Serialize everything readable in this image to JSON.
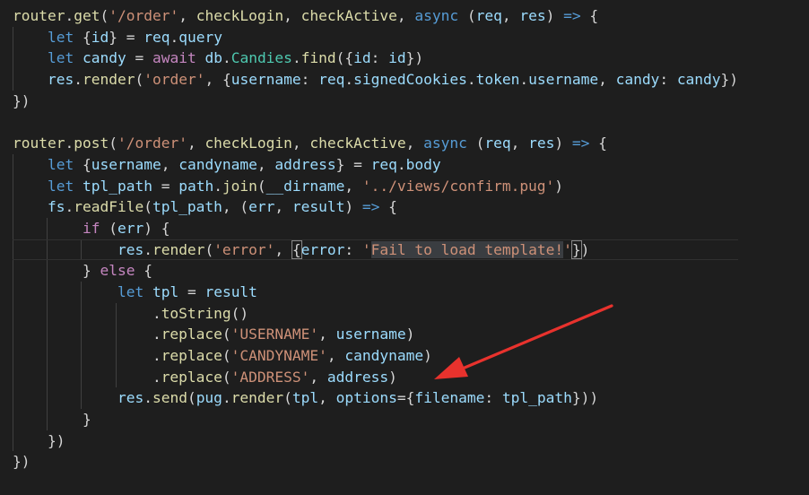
{
  "editor": {
    "lines": [
      [
        [
          "router",
          "fn"
        ],
        [
          ".",
          ""
        ],
        [
          "get",
          "fn"
        ],
        [
          "(",
          ""
        ],
        [
          "'/order'",
          "str"
        ],
        [
          ", ",
          ""
        ],
        [
          "checkLogin",
          "fn"
        ],
        [
          ", ",
          ""
        ],
        [
          "checkActive",
          "fn"
        ],
        [
          ", ",
          ""
        ],
        [
          "async",
          "kw"
        ],
        [
          " (",
          ""
        ],
        [
          "req",
          "var"
        ],
        [
          ", ",
          ""
        ],
        [
          "res",
          "var"
        ],
        [
          ") ",
          ""
        ],
        [
          "=>",
          "kw"
        ],
        [
          " {",
          ""
        ]
      ],
      [
        [
          "let",
          "kw"
        ],
        [
          " {",
          ""
        ],
        [
          "id",
          "var"
        ],
        [
          "} = ",
          ""
        ],
        [
          "req",
          "var"
        ],
        [
          ".",
          ""
        ],
        [
          "query",
          "var"
        ]
      ],
      [
        [
          "let",
          "kw"
        ],
        [
          " ",
          ""
        ],
        [
          "candy",
          "var"
        ],
        [
          " = ",
          ""
        ],
        [
          "await",
          "ctl"
        ],
        [
          " ",
          ""
        ],
        [
          "db",
          "var"
        ],
        [
          ".",
          ""
        ],
        [
          "Candies",
          "type"
        ],
        [
          ".",
          ""
        ],
        [
          "find",
          "fn"
        ],
        [
          "({",
          ""
        ],
        [
          "id",
          "var"
        ],
        [
          ": ",
          ""
        ],
        [
          "id",
          "var"
        ],
        [
          "})",
          ""
        ]
      ],
      [
        [
          "res",
          "var"
        ],
        [
          ".",
          ""
        ],
        [
          "render",
          "fn"
        ],
        [
          "(",
          ""
        ],
        [
          "'order'",
          "str"
        ],
        [
          ", {",
          ""
        ],
        [
          "username",
          "var"
        ],
        [
          ": ",
          ""
        ],
        [
          "req",
          "var"
        ],
        [
          ".",
          ""
        ],
        [
          "signedCookies",
          "var"
        ],
        [
          ".",
          ""
        ],
        [
          "token",
          "var"
        ],
        [
          ".",
          ""
        ],
        [
          "username",
          "var"
        ],
        [
          ", ",
          ""
        ],
        [
          "candy",
          "var"
        ],
        [
          ": ",
          ""
        ],
        [
          "candy",
          "var"
        ],
        [
          "})",
          ""
        ]
      ],
      [
        [
          "})",
          ""
        ]
      ],
      [],
      [
        [
          "router",
          "fn"
        ],
        [
          ".",
          ""
        ],
        [
          "post",
          "fn"
        ],
        [
          "(",
          ""
        ],
        [
          "'/order'",
          "str"
        ],
        [
          ", ",
          ""
        ],
        [
          "checkLogin",
          "fn"
        ],
        [
          ", ",
          ""
        ],
        [
          "checkActive",
          "fn"
        ],
        [
          ", ",
          ""
        ],
        [
          "async",
          "kw"
        ],
        [
          " (",
          ""
        ],
        [
          "req",
          "var"
        ],
        [
          ", ",
          ""
        ],
        [
          "res",
          "var"
        ],
        [
          ") ",
          ""
        ],
        [
          "=>",
          "kw"
        ],
        [
          " {",
          ""
        ]
      ],
      [
        [
          "let",
          "kw"
        ],
        [
          " {",
          ""
        ],
        [
          "username",
          "var"
        ],
        [
          ", ",
          ""
        ],
        [
          "candyname",
          "var"
        ],
        [
          ", ",
          ""
        ],
        [
          "address",
          "var"
        ],
        [
          "} = ",
          ""
        ],
        [
          "req",
          "var"
        ],
        [
          ".",
          ""
        ],
        [
          "body",
          "var"
        ]
      ],
      [
        [
          "let",
          "kw"
        ],
        [
          " ",
          ""
        ],
        [
          "tpl_path",
          "var"
        ],
        [
          " = ",
          ""
        ],
        [
          "path",
          "var"
        ],
        [
          ".",
          ""
        ],
        [
          "join",
          "fn"
        ],
        [
          "(",
          ""
        ],
        [
          "__dirname",
          "var"
        ],
        [
          ", ",
          ""
        ],
        [
          "'../views/confirm.pug'",
          "str"
        ],
        [
          ")",
          ""
        ]
      ],
      [
        [
          "fs",
          "var"
        ],
        [
          ".",
          ""
        ],
        [
          "readFile",
          "fn"
        ],
        [
          "(",
          ""
        ],
        [
          "tpl_path",
          "var"
        ],
        [
          ", (",
          ""
        ],
        [
          "err",
          "var"
        ],
        [
          ", ",
          ""
        ],
        [
          "result",
          "var"
        ],
        [
          ") ",
          ""
        ],
        [
          "=>",
          "kw"
        ],
        [
          " {",
          ""
        ]
      ],
      [
        [
          "if",
          "ctl"
        ],
        [
          " (",
          ""
        ],
        [
          "err",
          "var"
        ],
        [
          ") {",
          ""
        ]
      ],
      [
        [
          "res",
          "var"
        ],
        [
          ".",
          ""
        ],
        [
          "render",
          "fn"
        ],
        [
          "(",
          ""
        ],
        [
          "'error'",
          "str"
        ],
        [
          ", ",
          ""
        ],
        [
          "{",
          "brace"
        ],
        [
          "error",
          "var"
        ],
        [
          ": ",
          ""
        ],
        [
          "'",
          "str"
        ],
        [
          "Fail to load template!",
          "selstr"
        ],
        [
          "'",
          "str"
        ],
        [
          "}",
          "brace"
        ],
        [
          ")",
          ""
        ]
      ],
      [
        [
          "} ",
          ""
        ],
        [
          "else",
          "ctl"
        ],
        [
          " {",
          ""
        ]
      ],
      [
        [
          "let",
          "kw"
        ],
        [
          " ",
          ""
        ],
        [
          "tpl",
          "var"
        ],
        [
          " = ",
          ""
        ],
        [
          "result",
          "var"
        ]
      ],
      [
        [
          ".",
          ""
        ],
        [
          "toString",
          "fn"
        ],
        [
          "()",
          ""
        ]
      ],
      [
        [
          ".",
          ""
        ],
        [
          "replace",
          "fn"
        ],
        [
          "(",
          ""
        ],
        [
          "'USERNAME'",
          "str"
        ],
        [
          ", ",
          ""
        ],
        [
          "username",
          "var"
        ],
        [
          ")",
          ""
        ]
      ],
      [
        [
          ".",
          ""
        ],
        [
          "replace",
          "fn"
        ],
        [
          "(",
          ""
        ],
        [
          "'CANDYNAME'",
          "str"
        ],
        [
          ", ",
          ""
        ],
        [
          "candyname",
          "var"
        ],
        [
          ")",
          ""
        ]
      ],
      [
        [
          ".",
          ""
        ],
        [
          "replace",
          "fn"
        ],
        [
          "(",
          ""
        ],
        [
          "'ADDRESS'",
          "str"
        ],
        [
          ", ",
          ""
        ],
        [
          "address",
          "var"
        ],
        [
          ")",
          ""
        ]
      ],
      [
        [
          "res",
          "var"
        ],
        [
          ".",
          ""
        ],
        [
          "send",
          "fn"
        ],
        [
          "(",
          ""
        ],
        [
          "pug",
          "var"
        ],
        [
          ".",
          ""
        ],
        [
          "render",
          "fn"
        ],
        [
          "(",
          ""
        ],
        [
          "tpl",
          "var"
        ],
        [
          ", ",
          ""
        ],
        [
          "options",
          "var"
        ],
        [
          "={",
          ""
        ],
        [
          "filename",
          "var"
        ],
        [
          ": ",
          ""
        ],
        [
          "tpl_path",
          "var"
        ],
        [
          "}))",
          ""
        ]
      ],
      [
        [
          "}",
          ""
        ]
      ],
      [
        [
          "})",
          ""
        ]
      ],
      [
        [
          "})",
          ""
        ]
      ]
    ],
    "indents": [
      0,
      1,
      1,
      1,
      0,
      0,
      0,
      1,
      1,
      1,
      2,
      3,
      2,
      3,
      4,
      4,
      4,
      4,
      3,
      2,
      1,
      0
    ],
    "cursor_line": 11
  },
  "annotation": {
    "arrow_color": "#e8322d",
    "arrow_icon": "red-arrow-icon"
  }
}
